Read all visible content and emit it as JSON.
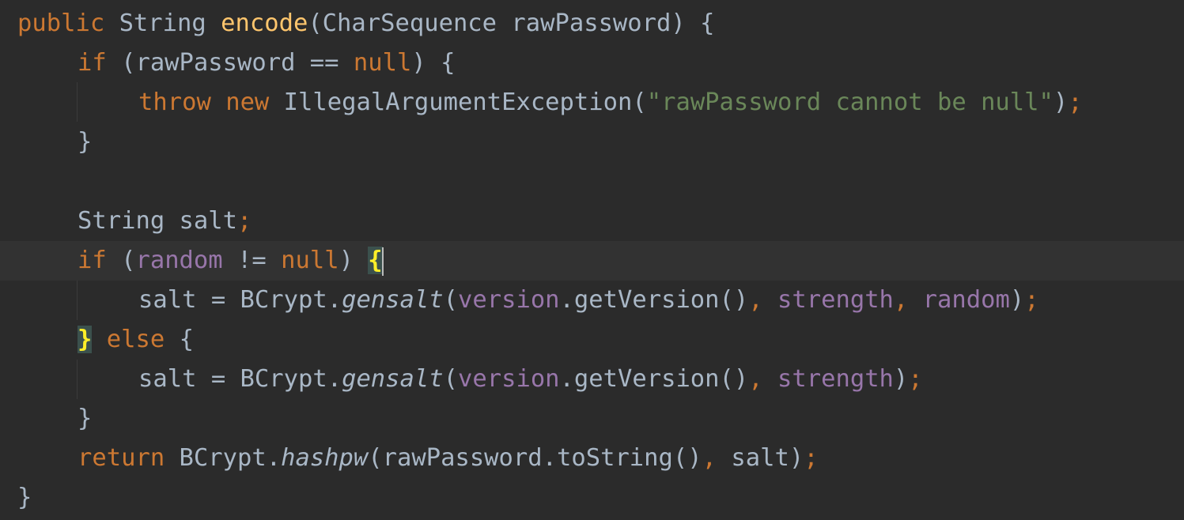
{
  "editor": {
    "language": "Java",
    "theme": "Darcula",
    "colors": {
      "background": "#2b2b2b",
      "current_line": "#323232",
      "keyword": "#cc7832",
      "method_declaration": "#ffc66d",
      "string": "#6a8759",
      "field": "#9876aa",
      "default_text": "#a9b7c6",
      "brace_match": "#ffef28"
    },
    "caret_line": 7,
    "lines": [
      {
        "tokens": [
          "public",
          " ",
          "String",
          " ",
          "encode",
          "(CharSequence rawPassword) {"
        ]
      },
      {
        "tokens": [
          "if",
          " (rawPassword == ",
          "null",
          ") {"
        ]
      },
      {
        "tokens": [
          "throw",
          " ",
          "new",
          " IllegalArgumentException(",
          "\"rawPassword cannot be null\"",
          ")",
          ";"
        ]
      },
      {
        "tokens": [
          "}"
        ]
      },
      {
        "tokens": [
          ""
        ]
      },
      {
        "tokens": [
          "String salt",
          ";"
        ]
      },
      {
        "tokens": [
          "if",
          " (",
          "random",
          " != ",
          "null",
          ") ",
          "{"
        ]
      },
      {
        "tokens": [
          "salt = BCrypt.",
          "gensalt",
          "(",
          "version",
          ".getVersion()",
          ",",
          " ",
          "strength",
          ",",
          " ",
          "random",
          ")",
          ";"
        ]
      },
      {
        "tokens": [
          "}",
          " ",
          "else",
          " {"
        ]
      },
      {
        "tokens": [
          "salt = BCrypt.",
          "gensalt",
          "(",
          "version",
          ".getVersion()",
          ",",
          " ",
          "strength",
          ")",
          ";"
        ]
      },
      {
        "tokens": [
          "}"
        ]
      },
      {
        "tokens": [
          "return",
          " BCrypt.",
          "hashpw",
          "(rawPassword.toString()",
          ",",
          " salt)",
          ";"
        ]
      },
      {
        "tokens": [
          "}"
        ]
      }
    ]
  }
}
